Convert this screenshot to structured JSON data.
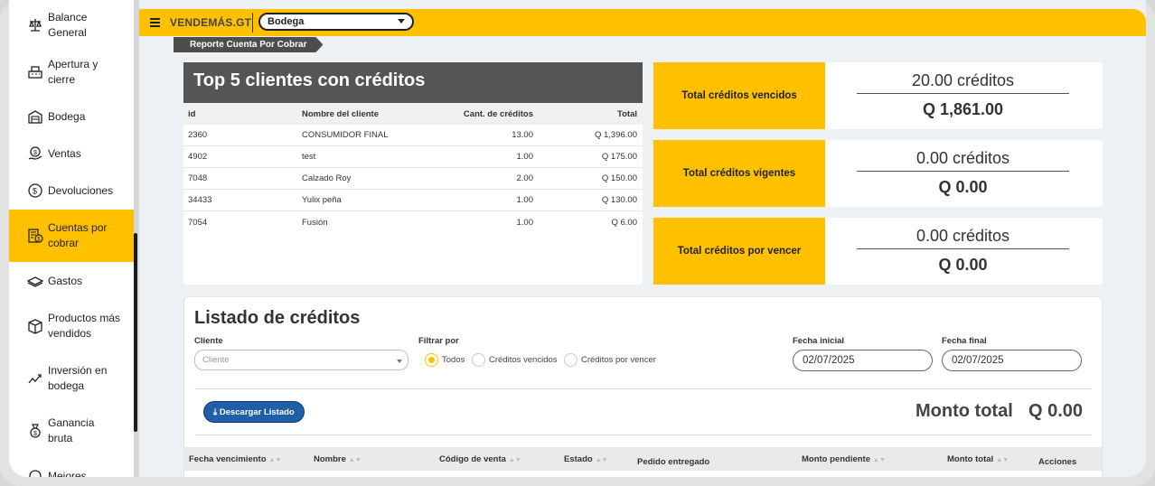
{
  "sidebar": {
    "items": [
      {
        "label_line1": "Balance",
        "label_line2": "General",
        "icon": "scale-icon"
      },
      {
        "label_line1": "Apertura y",
        "label_line2": "cierre",
        "icon": "cash-register-icon"
      },
      {
        "label_line1": "Bodega",
        "label_line2": "",
        "icon": "warehouse-icon"
      },
      {
        "label_line1": "Ventas",
        "label_line2": "",
        "icon": "sales-icon"
      },
      {
        "label_line1": "Devoluciones",
        "label_line2": "",
        "icon": "refund-icon"
      },
      {
        "label_line1": "Cuentas por",
        "label_line2": "cobrar",
        "icon": "accounts-receivable-icon",
        "active": true
      },
      {
        "label_line1": "Gastos",
        "label_line2": "",
        "icon": "money-icon"
      },
      {
        "label_line1": "Productos más",
        "label_line2": "vendidos",
        "icon": "box-icon"
      },
      {
        "label_line1": "Inversión en",
        "label_line2": "bodega",
        "icon": "investment-icon"
      },
      {
        "label_line1": "Ganancia",
        "label_line2": "bruta",
        "icon": "profit-icon"
      },
      {
        "label_line1": "Mejores",
        "label_line2": "",
        "icon": "ranking-icon"
      }
    ]
  },
  "header": {
    "brand": "VENDEMÁS.GT",
    "store_select": "Bodega",
    "breadcrumb": "Reporte Cuenta Por Cobrar"
  },
  "top5": {
    "title": "Top 5 clientes con créditos",
    "columns": [
      "id",
      "Nombre del cliente",
      "Cant. de créditos",
      "Total"
    ],
    "rows": [
      {
        "id": "2360",
        "name": "CONSUMIDOR FINAL",
        "cant": "13.00",
        "total": "Q 1,396.00"
      },
      {
        "id": "4902",
        "name": "test",
        "cant": "1.00",
        "total": "Q 175.00"
      },
      {
        "id": "7048",
        "name": "Calzado Roy",
        "cant": "2.00",
        "total": "Q 150.00"
      },
      {
        "id": "34433",
        "name": "Yulix peña",
        "cant": "1.00",
        "total": "Q 130.00"
      },
      {
        "id": "7054",
        "name": "Fusión",
        "cant": "1.00",
        "total": "Q 6.00"
      }
    ]
  },
  "stats": [
    {
      "label": "Total créditos vencidos",
      "credits": "20.00 créditos",
      "amount": "Q 1,861.00"
    },
    {
      "label": "Total créditos vigentes",
      "credits": "0.00 créditos",
      "amount": "Q 0.00"
    },
    {
      "label": "Total créditos por vencer",
      "credits": "0.00 créditos",
      "amount": "Q 0.00"
    }
  ],
  "listado": {
    "title": "Listado de créditos",
    "cliente_label": "Cliente",
    "cliente_placeholder": "Cliente",
    "filtrar_label": "Filtrar por",
    "filters": [
      "Todos",
      "Créditos vencidos",
      "Créditos por vencer"
    ],
    "selected_filter": "Todos",
    "fecha_inicial_label": "Fecha inicial",
    "fecha_inicial": "02/07/2025",
    "fecha_final_label": "Fecha final",
    "fecha_final": "02/07/2025",
    "download_label": "Descargar Listado",
    "monto_total_label": "Monto total",
    "monto_total": "Q 0.00",
    "columns": [
      "Fecha vencimiento",
      "Nombre",
      "Código de venta",
      "Estado",
      "Pedido entregado",
      "Monto pendiente",
      "Monto total",
      "Acciones"
    ]
  },
  "colors": {
    "accent": "#ffc000",
    "dark_header": "#555555",
    "button_blue": "#1e5fa8"
  }
}
